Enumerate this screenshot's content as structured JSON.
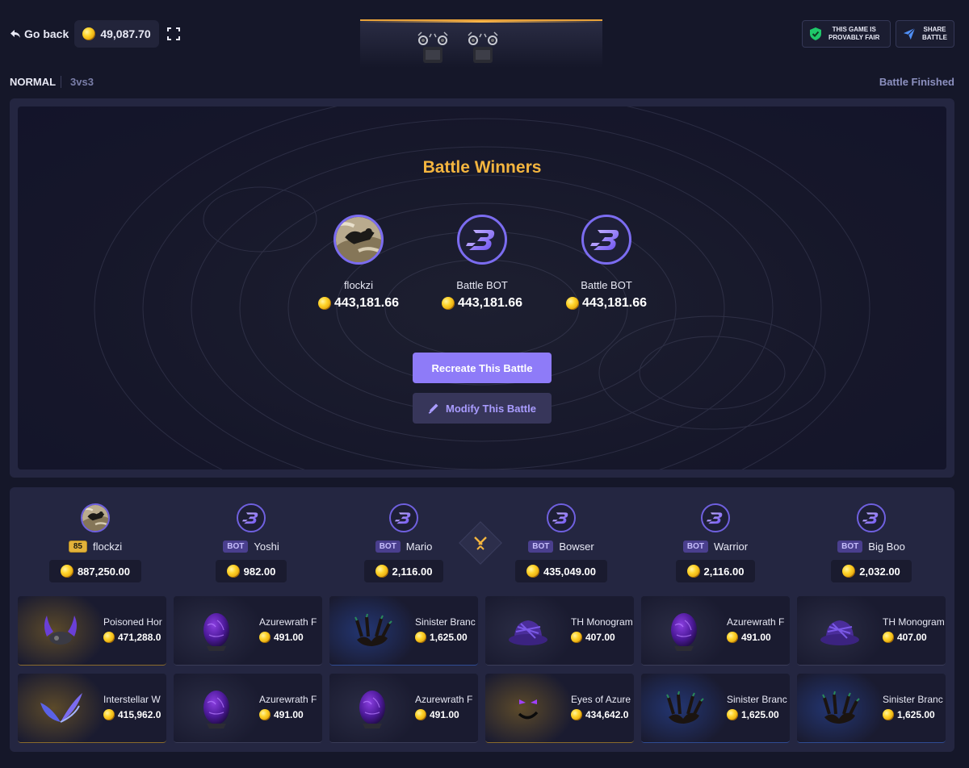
{
  "topbar": {
    "back_label": "Go back",
    "balance": "49,087.70",
    "fair_label_1": "THIS GAME IS",
    "fair_label_2": "PROVABLY FAIR",
    "share_label_1": "SHARE",
    "share_label_2": "BATTLE"
  },
  "mode": {
    "name": "NORMAL",
    "type": "3vs3",
    "status": "Battle Finished"
  },
  "winners": {
    "title": "Battle Winners",
    "list": [
      {
        "name": "flockzi",
        "amount": "443,181.66",
        "avatar": "user-photo"
      },
      {
        "name": "Battle BOT",
        "amount": "443,181.66",
        "avatar": "bot-logo"
      },
      {
        "name": "Battle BOT",
        "amount": "443,181.66",
        "avatar": "bot-logo"
      }
    ],
    "recreate_label": "Recreate This Battle",
    "modify_label": "Modify This Battle"
  },
  "players": [
    {
      "name": "flockzi",
      "badge": "85",
      "badge_type": "level",
      "total": "887,250.00",
      "avatar": "user-photo"
    },
    {
      "name": "Yoshi",
      "badge": "BOT",
      "badge_type": "bot",
      "total": "982.00",
      "avatar": "bot-logo"
    },
    {
      "name": "Mario",
      "badge": "BOT",
      "badge_type": "bot",
      "total": "2,116.00",
      "avatar": "bot-logo"
    },
    {
      "name": "Bowser",
      "badge": "BOT",
      "badge_type": "bot",
      "total": "435,049.00",
      "avatar": "bot-logo"
    },
    {
      "name": "Warrior",
      "badge": "BOT",
      "badge_type": "bot",
      "total": "2,116.00",
      "avatar": "bot-logo"
    },
    {
      "name": "Big Boo",
      "badge": "BOT",
      "badge_type": "bot",
      "total": "2,032.00",
      "avatar": "bot-logo"
    }
  ],
  "items": [
    [
      {
        "name": "Poisoned Hor",
        "price": "471,288.0",
        "rarity": "gold",
        "icon": "horns-icon"
      },
      {
        "name": "Interstellar W",
        "price": "415,962.0",
        "rarity": "gold",
        "icon": "wings-icon"
      }
    ],
    [
      {
        "name": "Azurewrath F",
        "price": "491.00",
        "rarity": "gray",
        "icon": "egg-icon"
      },
      {
        "name": "Azurewrath F",
        "price": "491.00",
        "rarity": "gray",
        "icon": "egg-icon"
      }
    ],
    [
      {
        "name": "Sinister Branc",
        "price": "1,625.00",
        "rarity": "blue",
        "icon": "branches-icon"
      },
      {
        "name": "Azurewrath F",
        "price": "491.00",
        "rarity": "gray",
        "icon": "egg-icon"
      }
    ],
    [
      {
        "name": "TH Monogram",
        "price": "407.00",
        "rarity": "gray",
        "icon": "hat-icon"
      },
      {
        "name": "Eyes of Azure",
        "price": "434,642.0",
        "rarity": "gold",
        "icon": "face-icon"
      }
    ],
    [
      {
        "name": "Azurewrath F",
        "price": "491.00",
        "rarity": "gray",
        "icon": "egg-icon"
      },
      {
        "name": "Sinister Branc",
        "price": "1,625.00",
        "rarity": "blue",
        "icon": "branches-icon"
      }
    ],
    [
      {
        "name": "TH Monogram",
        "price": "407.00",
        "rarity": "gray",
        "icon": "hat-icon"
      },
      {
        "name": "Sinister Branc",
        "price": "1,625.00",
        "rarity": "blue",
        "icon": "branches-icon"
      }
    ]
  ],
  "colors": {
    "accent": "#8e7bf8",
    "title": "#f4b53f",
    "background": "#151729",
    "panel": "#242641"
  }
}
